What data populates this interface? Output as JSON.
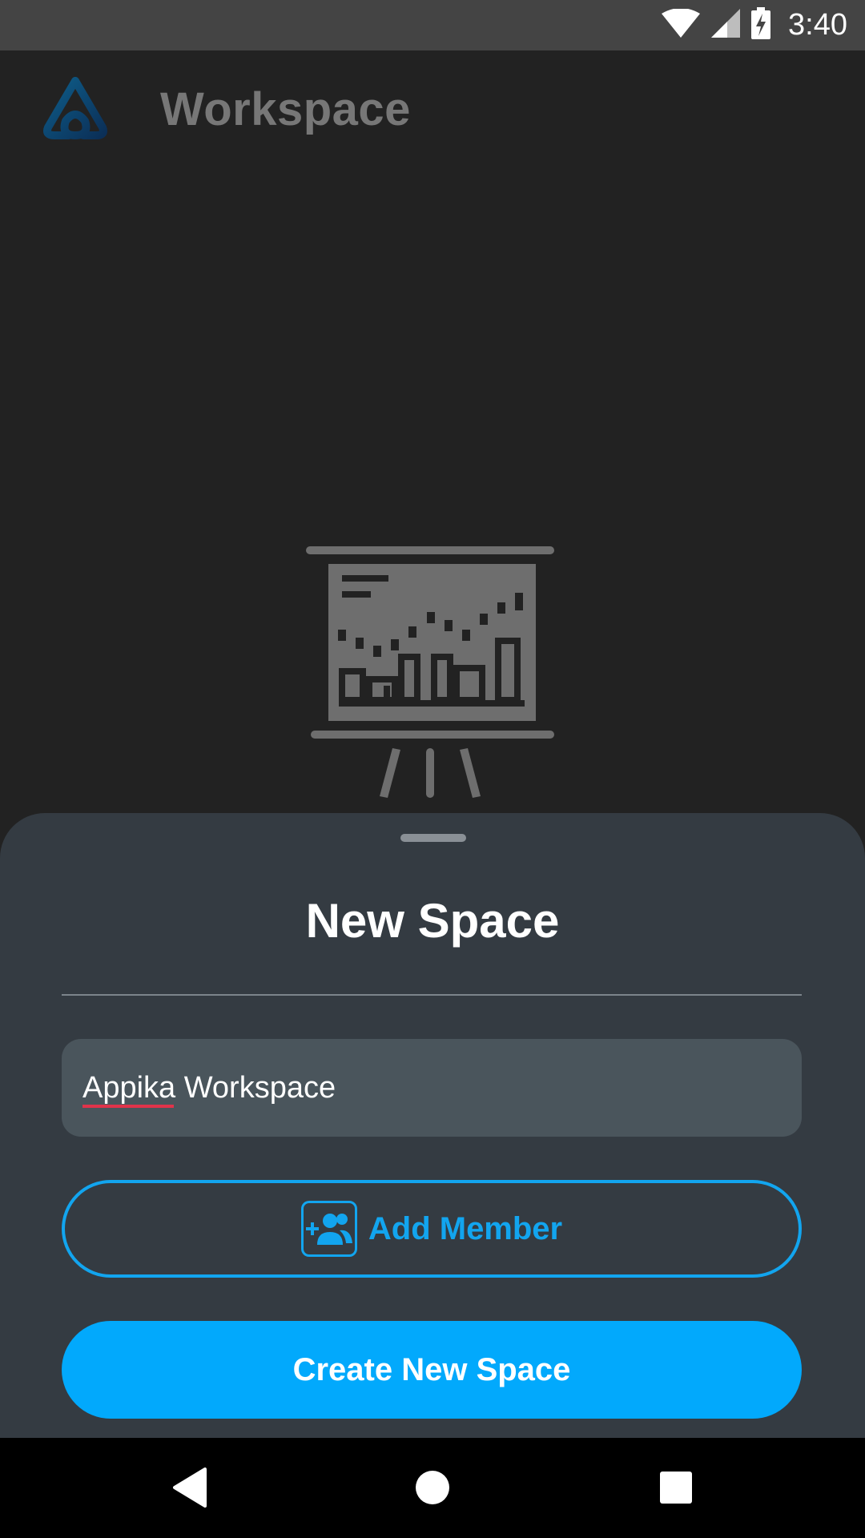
{
  "status_bar": {
    "time": "3:40",
    "icons": [
      "wifi-icon",
      "cell-signal-icon",
      "battery-charging-icon"
    ]
  },
  "app_bar": {
    "logo": "workspace-logo-icon",
    "title": "Workspace"
  },
  "illustration": {
    "icon": "presentation-board-chart-icon"
  },
  "sheet": {
    "title": "New Space",
    "name_field": {
      "value": "Appika Workspace"
    },
    "add_member": {
      "label": "Add Member",
      "icon": "add-group-icon"
    },
    "create_button": {
      "label": "Create New Space"
    }
  },
  "nav_bar": {
    "icons": [
      "back-icon",
      "home-icon",
      "recents-icon"
    ]
  },
  "colors": {
    "accent": "#02a9fc",
    "sheet_background": "#343b42",
    "field_background": "#4a555c",
    "background": "#222222"
  }
}
